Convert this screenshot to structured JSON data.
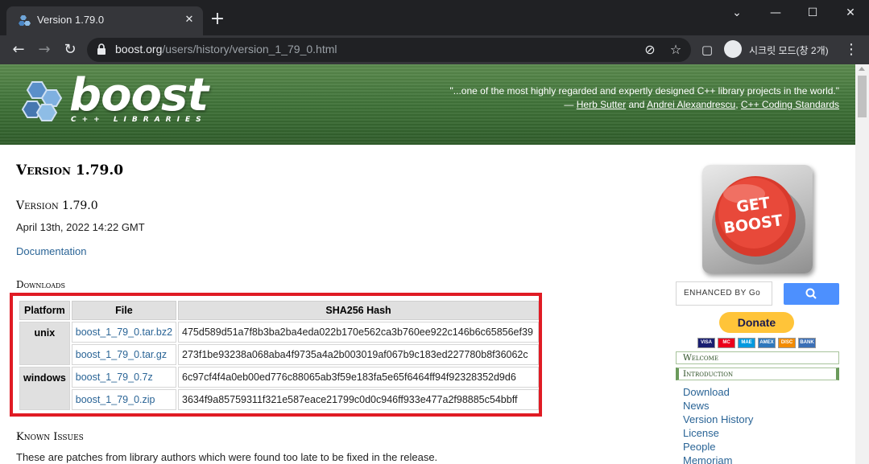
{
  "browser": {
    "tab_title": "Version 1.79.0",
    "url_host": "boost.org",
    "url_path": "/users/history/version_1_79_0.html",
    "incognito_label": "시크릿 모드(창 2개)"
  },
  "banner": {
    "logo_word": "boost",
    "logo_sub": "C++ LIBRARIES",
    "quote_line1": "\"...one of the most highly regarded and expertly designed C++ library projects in the world.\"",
    "quote_dash": "— ",
    "author1": "Herb Sutter",
    "and_word": " and ",
    "author2": "Andrei Alexandrescu",
    "comma": ", ",
    "book": "C++ Coding Standards"
  },
  "main": {
    "title": "Version 1.79.0",
    "subtitle": "Version 1.79.0",
    "date": "April 13th, 2022 14:22 GMT",
    "documentation_link": "Documentation",
    "downloads_heading": "Downloads",
    "table": {
      "headers": [
        "Platform",
        "File",
        "SHA256 Hash"
      ],
      "rows": [
        {
          "platform": "unix",
          "file": "boost_1_79_0.tar.bz2",
          "hash": "475d589d51a7f8b3ba2ba4eda022b170e562ca3b760ee922c146b6c65856ef39"
        },
        {
          "platform": "",
          "file": "boost_1_79_0.tar.gz",
          "hash": "273f1be93238a068aba4f9735a4a2b003019af067b9c183ed227780b8f36062c"
        },
        {
          "platform": "windows",
          "file": "boost_1_79_0.7z",
          "hash": "6c97cf4f4a0eb00ed776c88065ab3f59e183fa5e65f6464ff94f92328352d9d6"
        },
        {
          "platform": "",
          "file": "boost_1_79_0.zip",
          "hash": "3634f9a85759311f321e587eace21799c0d0c946ff933e477a2f98885c54bbff"
        }
      ]
    },
    "known_issues_heading": "Known Issues",
    "known_issues_text": "These are patches from library authors which were found too late to be fixed in the release."
  },
  "sidebar": {
    "getboost_line1": "GET",
    "getboost_line2": "BOOST",
    "search_placeholder": "ENHANCED BY Go",
    "donate_label": "Donate",
    "cards": [
      "VISA",
      "MC",
      "MAE",
      "AMEX",
      "DISC",
      "BANK"
    ],
    "section_welcome": "Welcome",
    "section_introduction": "Introduction",
    "links": [
      "Download",
      "News",
      "Version History",
      "License",
      "People",
      "Memoriam"
    ]
  },
  "colors": {
    "accent_red": "#e01b24",
    "link_blue": "#2a6496",
    "banner_green": "#3f7238",
    "donate_yellow": "#ffc439"
  }
}
